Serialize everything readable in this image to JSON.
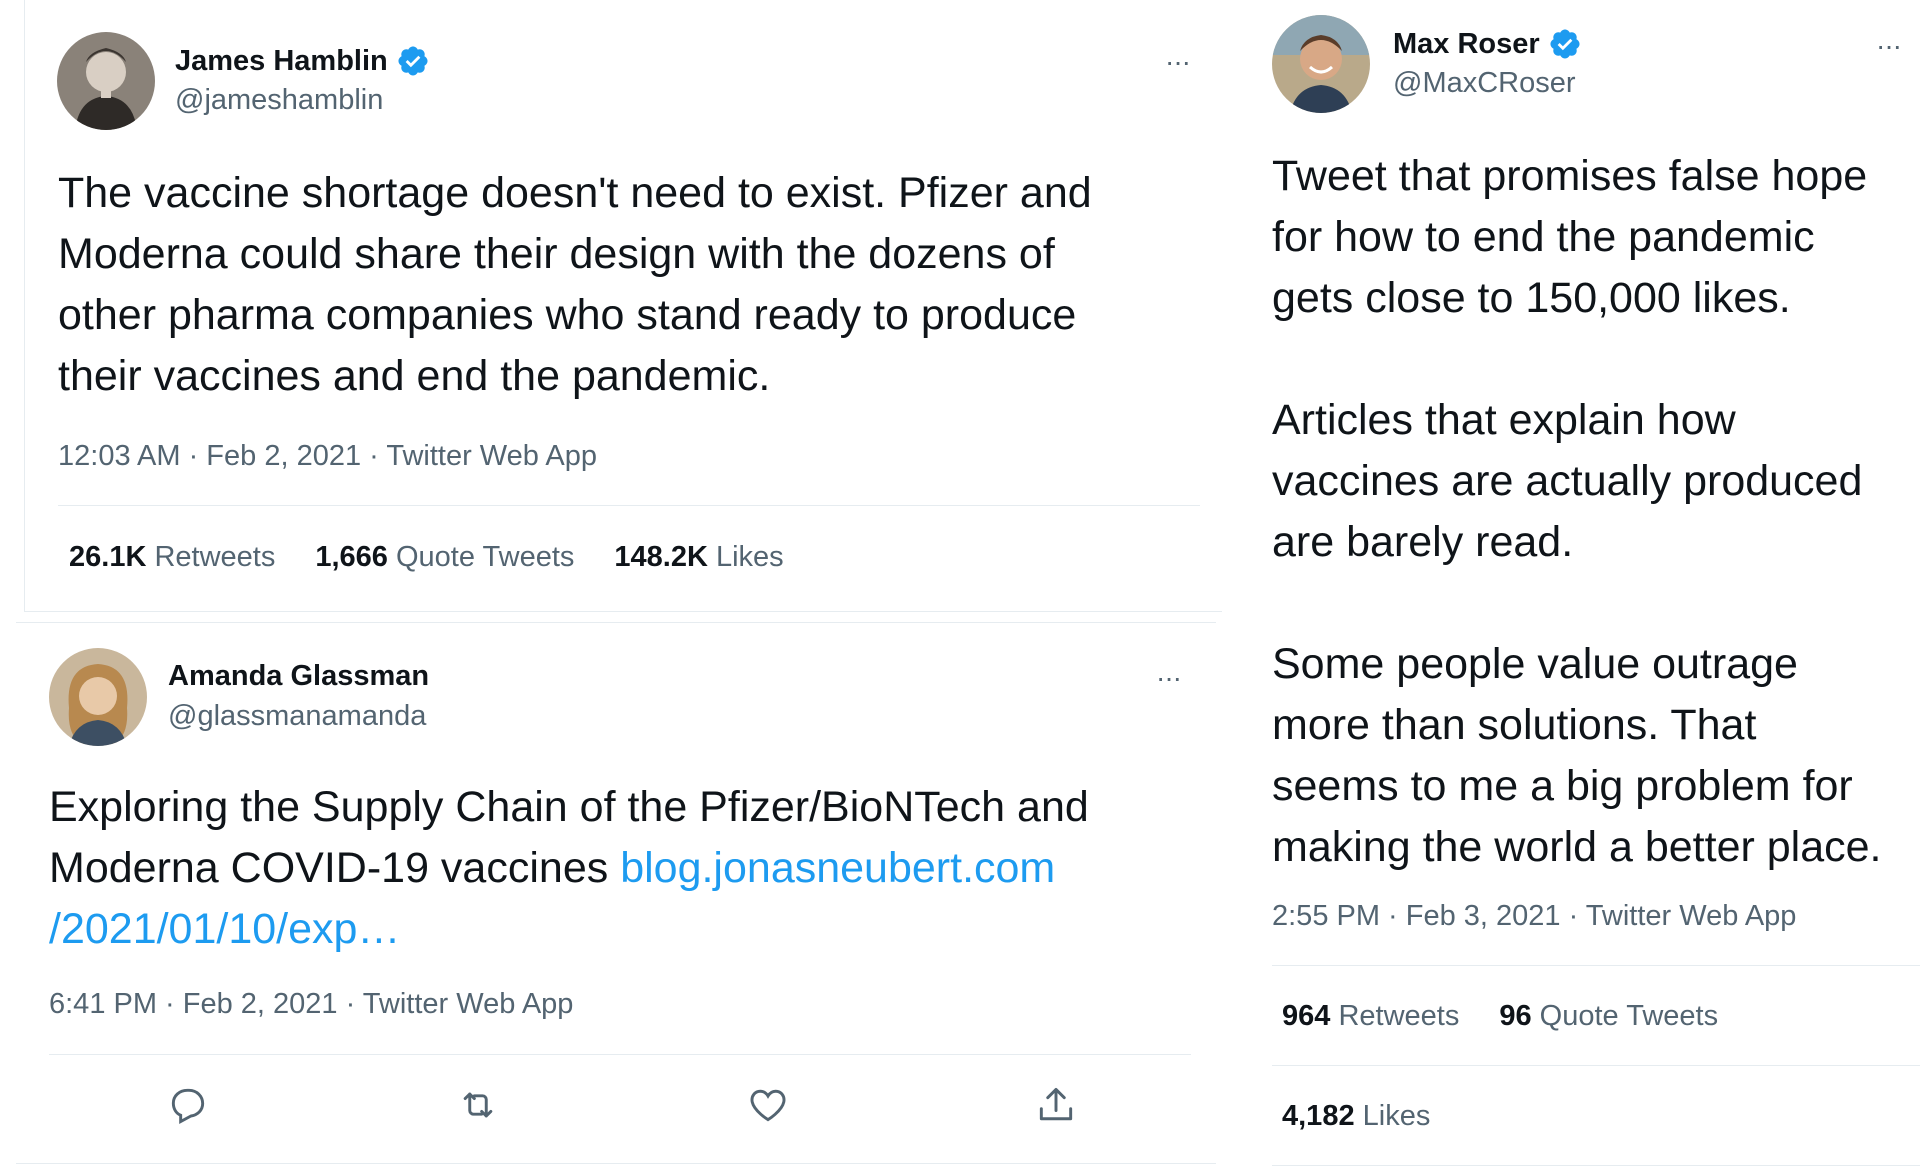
{
  "tweets": [
    {
      "display_name": "James Hamblin",
      "handle": "@jameshamblin",
      "verified": true,
      "more_label": "···",
      "text": "The vaccine shortage doesn't need to exist. Pfizer and\nModerna could share their design with the dozens of\nother pharma companies who stand ready to produce\ntheir vaccines and end the pandemic.",
      "meta": "12:03 AM · Feb 2, 2021 · Twitter Web App",
      "stats": [
        {
          "value": "26.1K",
          "label": "Retweets"
        },
        {
          "value": "1,666",
          "label": "Quote Tweets"
        },
        {
          "value": "148.2K",
          "label": "Likes"
        }
      ]
    },
    {
      "display_name": "Amanda Glassman",
      "handle": "@glassmanamanda",
      "verified": false,
      "more_label": "···",
      "text_prefix": "Exploring the Supply Chain of the Pfizer/BioNTech and\nModerna COVID-19 vaccines ",
      "link_text": "blog.jonasneubert.com\n/2021/01/10/exp…",
      "meta": "6:41 PM · Feb 2, 2021 · Twitter Web App",
      "actions": [
        "reply-icon",
        "retweet-icon",
        "like-icon",
        "share-icon"
      ]
    },
    {
      "display_name": "Max Roser",
      "handle": "@MaxCRoser",
      "verified": true,
      "more_label": "···",
      "text": "Tweet that promises false hope\nfor how to end the pandemic\ngets close to 150,000 likes.\n\nArticles that explain how\nvaccines are actually produced\nare barely read.\n\nSome people value outrage\nmore than solutions. That\nseems to me a big problem for\nmaking the world a better place.",
      "meta": "2:55 PM · Feb 3, 2021 · Twitter Web App",
      "stats": [
        {
          "value": "964",
          "label": "Retweets"
        },
        {
          "value": "96",
          "label": "Quote Tweets"
        }
      ],
      "stats2": [
        {
          "value": "4,182",
          "label": "Likes"
        }
      ]
    }
  ],
  "colors": {
    "text": "#0f1419",
    "muted": "#536471",
    "link": "#1d9bf0",
    "divider": "#e6ecf0",
    "verified": "#1d9bf0"
  }
}
